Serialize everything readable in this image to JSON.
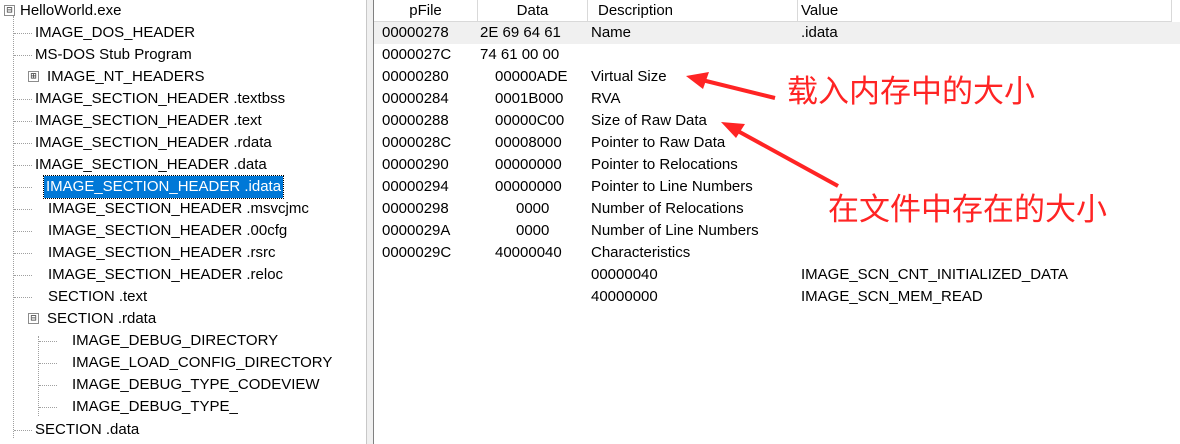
{
  "tree": {
    "items": [
      {
        "label": "HelloWorld.exe",
        "expander": "⊟"
      },
      {
        "label": "IMAGE_DOS_HEADER"
      },
      {
        "label": "MS-DOS Stub Program"
      },
      {
        "label": "IMAGE_NT_HEADERS",
        "expander": "⊞"
      },
      {
        "label": "IMAGE_SECTION_HEADER .textbss"
      },
      {
        "label": "IMAGE_SECTION_HEADER .text"
      },
      {
        "label": "IMAGE_SECTION_HEADER .rdata"
      },
      {
        "label": "IMAGE_SECTION_HEADER .data"
      },
      {
        "label": "IMAGE_SECTION_HEADER .idata",
        "selected": true
      },
      {
        "label": "IMAGE_SECTION_HEADER .msvcjmc"
      },
      {
        "label": "IMAGE_SECTION_HEADER .00cfg"
      },
      {
        "label": "IMAGE_SECTION_HEADER .rsrc"
      },
      {
        "label": "IMAGE_SECTION_HEADER .reloc"
      },
      {
        "label": "SECTION .text"
      },
      {
        "label": "SECTION .rdata",
        "expander": "⊟"
      },
      {
        "label": "IMAGE_DEBUG_DIRECTORY"
      },
      {
        "label": "IMAGE_LOAD_CONFIG_DIRECTORY"
      },
      {
        "label": "IMAGE_DEBUG_TYPE_CODEVIEW"
      },
      {
        "label": "IMAGE_DEBUG_TYPE_"
      },
      {
        "label": "SECTION .data"
      }
    ]
  },
  "table": {
    "columns": [
      "pFile",
      "Data",
      "Description",
      "Value"
    ],
    "rows": [
      {
        "pfile": "00000278",
        "data": "2E 69 64 61",
        "desc": "Name",
        "value": ".idata"
      },
      {
        "pfile": "0000027C",
        "data": "74 61 00 00",
        "desc": "",
        "value": ""
      },
      {
        "pfile": "00000280",
        "data": "00000ADE",
        "desc": "Virtual Size",
        "value": ""
      },
      {
        "pfile": "00000284",
        "data": "0001B000",
        "desc": "RVA",
        "value": ""
      },
      {
        "pfile": "00000288",
        "data": "00000C00",
        "desc": "Size of Raw Data",
        "value": ""
      },
      {
        "pfile": "0000028C",
        "data": "00008000",
        "desc": "Pointer to Raw Data",
        "value": ""
      },
      {
        "pfile": "00000290",
        "data": "00000000",
        "desc": "Pointer to Relocations",
        "value": ""
      },
      {
        "pfile": "00000294",
        "data": "00000000",
        "desc": "Pointer to Line Numbers",
        "value": ""
      },
      {
        "pfile": "00000298",
        "data": "0000",
        "desc": "Number of Relocations",
        "value": ""
      },
      {
        "pfile": "0000029A",
        "data": "0000",
        "desc": "Number of Line Numbers",
        "value": ""
      },
      {
        "pfile": "0000029C",
        "data": "40000040",
        "desc": "Characteristics",
        "value": ""
      },
      {
        "pfile": "",
        "data": "",
        "desc": "00000040",
        "value": "IMAGE_SCN_CNT_INITIALIZED_DATA"
      },
      {
        "pfile": "",
        "data": "",
        "desc": "40000000",
        "value": "IMAGE_SCN_MEM_READ"
      }
    ]
  },
  "annotations": {
    "virtual_size_note": "载入内存中的大小",
    "raw_size_note": "在文件中存在的大小",
    "color": "#ff2424"
  },
  "colors": {
    "selection": "#0078d7",
    "selected_row": "#f0f0f0"
  }
}
